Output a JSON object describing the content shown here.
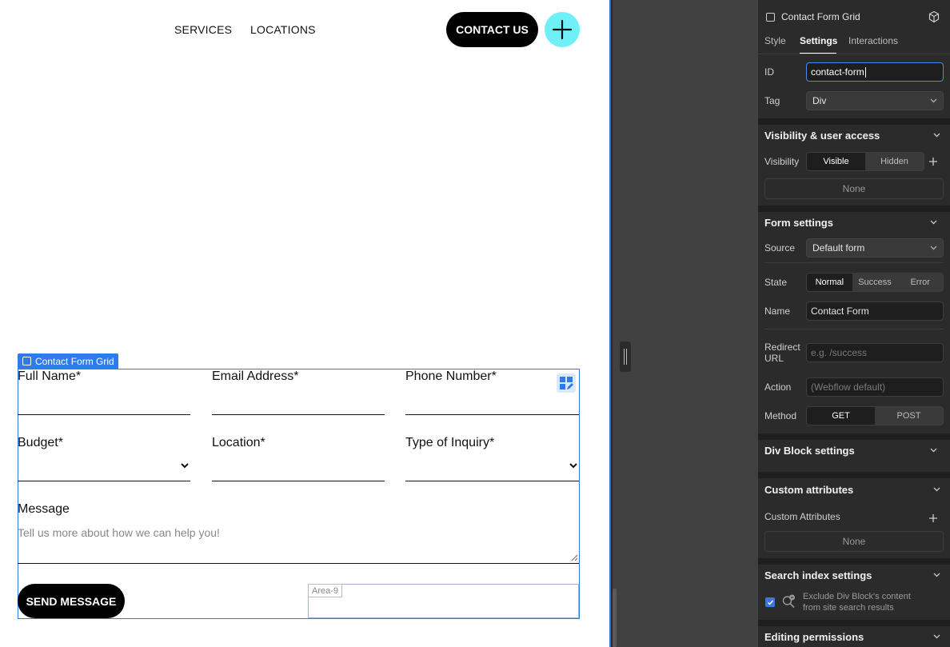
{
  "canvas": {
    "nav": {
      "services": "SERVICES",
      "locations": "LOCATIONS",
      "contact": "CONTACT US"
    },
    "grid": {
      "tag": "Contact Form Grid",
      "fields": {
        "full_name": "Full Name*",
        "email": "Email Address*",
        "phone": "Phone Number*",
        "budget": "Budget*",
        "location": "Location*",
        "inquiry": "Type of Inquiry*",
        "message": "Message",
        "message_placeholder": "Tell us more about how we can help you!"
      },
      "send": "SEND MESSAGE",
      "area_tag": "Area-9"
    }
  },
  "panel": {
    "element_name": "Contact Form Grid",
    "tabs": {
      "style": "Style",
      "settings": "Settings",
      "interactions": "Interactions"
    },
    "id": {
      "label": "ID",
      "value": "contact-form"
    },
    "tag": {
      "label": "Tag",
      "value": "Div"
    },
    "visibility": {
      "title": "Visibility & user access",
      "label": "Visibility",
      "visible": "Visible",
      "hidden": "Hidden",
      "none": "None"
    },
    "form": {
      "title": "Form settings",
      "source_label": "Source",
      "source_value": "Default form",
      "state_label": "State",
      "state_normal": "Normal",
      "state_success": "Success",
      "state_error": "Error",
      "name_label": "Name",
      "name_value": "Contact Form",
      "redirect_label_1": "Redirect",
      "redirect_label_2": "URL",
      "redirect_placeholder": "e.g. /success",
      "action_label": "Action",
      "action_placeholder": "(Webflow default)",
      "method_label": "Method",
      "method_get": "GET",
      "method_post": "POST"
    },
    "div_block": {
      "title": "Div Block settings"
    },
    "custom_attrs": {
      "title": "Custom attributes",
      "label": "Custom Attributes",
      "none": "None"
    },
    "search_index": {
      "title": "Search index settings",
      "exclude_line1": "Exclude Div Block's content",
      "exclude_line2": "from site search results"
    },
    "editing": {
      "title": "Editing permissions"
    }
  },
  "colors": {
    "accent": "#2f7bea",
    "plus_button": "#6ff0f7",
    "panel_bg": "#2b2b2b"
  }
}
